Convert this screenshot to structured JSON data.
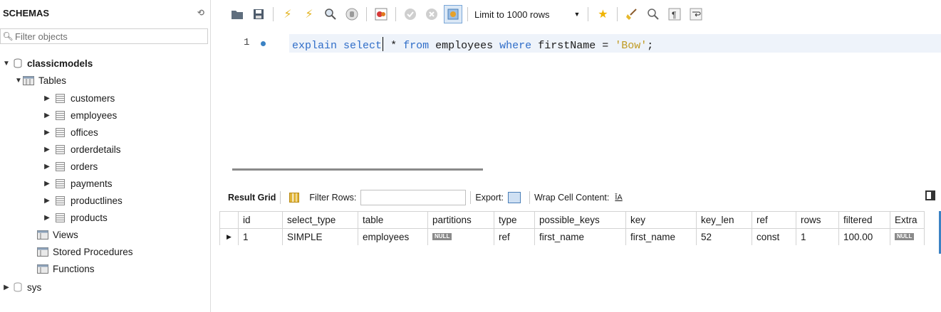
{
  "navigator": {
    "title": "SCHEMAS",
    "filter_placeholder": "Filter objects",
    "schemas": [
      {
        "name": "classicmodels",
        "tables_label": "Tables",
        "tables": [
          "customers",
          "employees",
          "offices",
          "orderdetails",
          "orders",
          "payments",
          "productlines",
          "products"
        ],
        "views_label": "Views",
        "procedures_label": "Stored Procedures",
        "functions_label": "Functions"
      },
      {
        "name": "sys"
      }
    ]
  },
  "toolbar": {
    "limit_label": "Limit to 1000 rows"
  },
  "editor": {
    "line_number": "1",
    "tokens": {
      "t1": "explain",
      "t2": "select",
      "t3": "*",
      "t4": "from",
      "t5": "employees",
      "t6": "where",
      "t7": "firstName",
      "t8": "=",
      "t9": "'Bow'",
      "t10": ";"
    }
  },
  "result": {
    "tab_label": "Result Grid",
    "filter_label": "Filter Rows:",
    "export_label": "Export:",
    "wrap_label": "Wrap Cell Content:",
    "wrap_icon_glyph": "ĪA",
    "columns": [
      "id",
      "select_type",
      "table",
      "partitions",
      "type",
      "possible_keys",
      "key",
      "key_len",
      "ref",
      "rows",
      "filtered",
      "Extra"
    ],
    "rows": [
      [
        "1",
        "SIMPLE",
        "employees",
        "NULL",
        "ref",
        "first_name",
        "first_name",
        "52",
        "const",
        "1",
        "100.00",
        "NULL"
      ]
    ]
  },
  "colors": {
    "keyword": "#2f6dc8",
    "string": "#c09a22",
    "accent": "#3b82c4"
  }
}
